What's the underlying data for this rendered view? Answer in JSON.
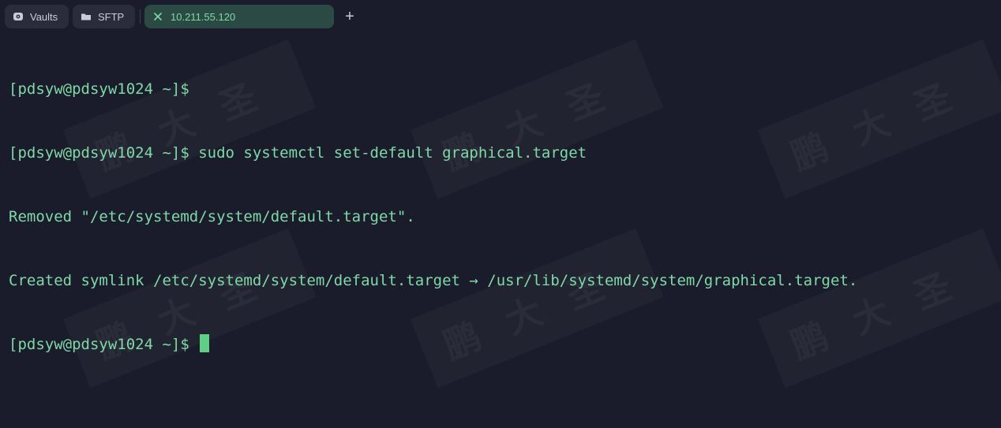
{
  "tabs": [
    {
      "label": "Vaults",
      "icon": "vault-icon"
    },
    {
      "label": "SFTP",
      "icon": "folder-icon"
    },
    {
      "label": "10.211.55.120",
      "icon": "host-close-icon",
      "active": true
    }
  ],
  "new_tab_label": "+",
  "terminal": {
    "lines": [
      "[pdsyw@pdsyw1024 ~]$",
      "[pdsyw@pdsyw1024 ~]$ sudo systemctl set-default graphical.target",
      "Removed \"/etc/systemd/system/default.target\".",
      "Created symlink /etc/systemd/system/default.target → /usr/lib/systemd/system/graphical.target.",
      "[pdsyw@pdsyw1024 ~]$ "
    ]
  },
  "watermark_text": "鹏大圣",
  "colors": {
    "background": "#1b1c2b",
    "terminal_text": "#7fd9a6",
    "active_tab": "#2b4a44",
    "cursor": "#5fcf86"
  }
}
